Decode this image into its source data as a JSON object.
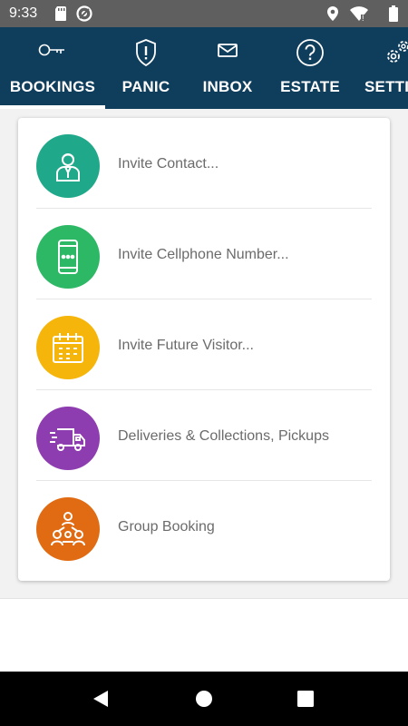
{
  "status_bar": {
    "time": "9:33",
    "icons": [
      "sd-card-icon",
      "sync-icon",
      "location-icon",
      "wifi-icon",
      "battery-icon"
    ]
  },
  "tabs": [
    {
      "label": "BOOKINGS",
      "icon": "key-icon",
      "selected": true
    },
    {
      "label": "PANIC",
      "icon": "shield-alert-icon",
      "selected": false
    },
    {
      "label": "INBOX",
      "icon": "mail-icon",
      "selected": false
    },
    {
      "label": "ESTATE",
      "icon": "help-circle-icon",
      "selected": false
    },
    {
      "label": "SETTI",
      "icon": "gears-icon",
      "selected": false
    }
  ],
  "booking_options": [
    {
      "label": "Invite Contact...",
      "icon": "contact-person-icon",
      "color": "#1fa98a"
    },
    {
      "label": "Invite Cellphone Number...",
      "icon": "cellphone-icon",
      "color": "#2db866"
    },
    {
      "label": "Invite Future Visitor...",
      "icon": "calendar-icon",
      "color": "#f5b50a"
    },
    {
      "label": "Deliveries & Collections, Pickups",
      "icon": "delivery-truck-icon",
      "color": "#8e3db0"
    },
    {
      "label": "Group Booking",
      "icon": "group-icon",
      "color": "#e06b12"
    }
  ],
  "colors": {
    "status_bar": "#5f5f5f",
    "tab_bar": "#0f3d5c",
    "content_bg": "#f2f2f2"
  },
  "nav_bar": {
    "buttons": [
      "back-icon",
      "home-icon",
      "recents-icon"
    ]
  }
}
